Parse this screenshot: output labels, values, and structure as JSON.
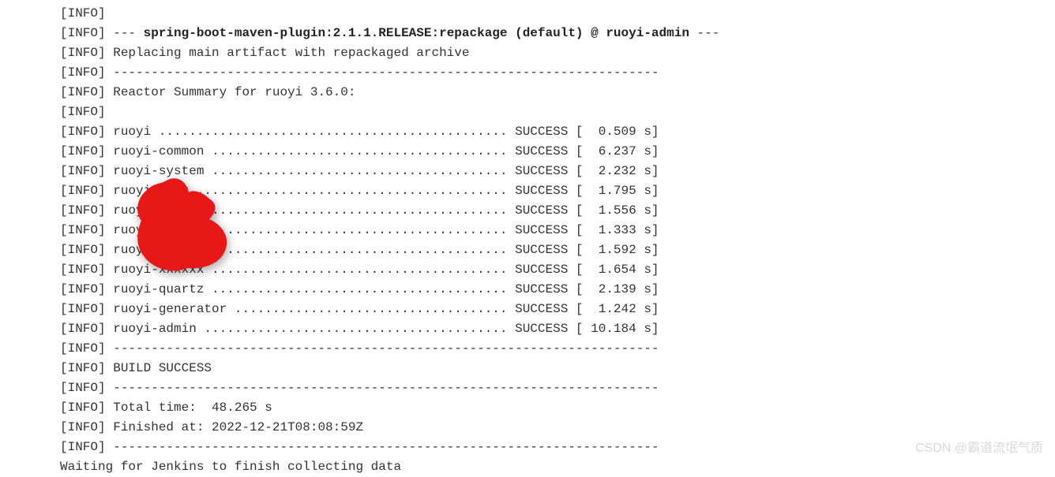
{
  "console": {
    "lines": [
      {
        "prefix": "[INFO]",
        "text": ""
      },
      {
        "prefix": "[INFO]",
        "text": " --- ",
        "bold": "spring-boot-maven-plugin:2.1.1.RELEASE:repackage (default) @ ruoyi-admin",
        "suffix": " ---"
      },
      {
        "prefix": "[INFO]",
        "text": " Replacing main artifact with repackaged archive"
      },
      {
        "prefix": "[INFO]",
        "text": " ------------------------------------------------------------------------"
      },
      {
        "prefix": "[INFO]",
        "text": " Reactor Summary for ruoyi 3.6.0:"
      },
      {
        "prefix": "[INFO]",
        "text": ""
      },
      {
        "prefix": "[INFO]",
        "text": " ruoyi .............................................. SUCCESS [  0.509 s]"
      },
      {
        "prefix": "[INFO]",
        "text": " ruoyi-common ....................................... SUCCESS [  6.237 s]"
      },
      {
        "prefix": "[INFO]",
        "text": " ruoyi-system ....................................... SUCCESS [  2.232 s]"
      },
      {
        "prefix": "[INFO]",
        "text": " ruoyi-xxxx ......................................... SUCCESS [  1.795 s]"
      },
      {
        "prefix": "[INFO]",
        "text": " ruoyi-xxxxx ........................................ SUCCESS [  1.556 s]"
      },
      {
        "prefix": "[INFO]",
        "text": " ruoyi-xxxxxx ....................................... SUCCESS [  1.333 s]"
      },
      {
        "prefix": "[INFO]",
        "text": " ruoyi-xxxxxxx ...................................... SUCCESS [  1.592 s]"
      },
      {
        "prefix": "[INFO]",
        "text": " ruoyi-xxxxxx ....................................... SUCCESS [  1.654 s]"
      },
      {
        "prefix": "[INFO]",
        "text": " ruoyi-quartz ....................................... SUCCESS [  2.139 s]"
      },
      {
        "prefix": "[INFO]",
        "text": " ruoyi-generator .................................... SUCCESS [  1.242 s]"
      },
      {
        "prefix": "[INFO]",
        "text": " ruoyi-admin ........................................ SUCCESS [ 10.184 s]"
      },
      {
        "prefix": "[INFO]",
        "text": " ------------------------------------------------------------------------"
      },
      {
        "prefix": "[INFO]",
        "text": " BUILD SUCCESS"
      },
      {
        "prefix": "[INFO]",
        "text": " ------------------------------------------------------------------------"
      },
      {
        "prefix": "[INFO]",
        "text": " Total time:  48.265 s"
      },
      {
        "prefix": "[INFO]",
        "text": " Finished at: 2022-12-21T08:08:59Z"
      },
      {
        "prefix": "[INFO]",
        "text": " ------------------------------------------------------------------------"
      },
      {
        "prefix": "",
        "text": "Waiting for Jenkins to finish collecting data"
      }
    ]
  },
  "watermark": "CSDN @霸道流氓气质",
  "redaction_color": "#e81818"
}
